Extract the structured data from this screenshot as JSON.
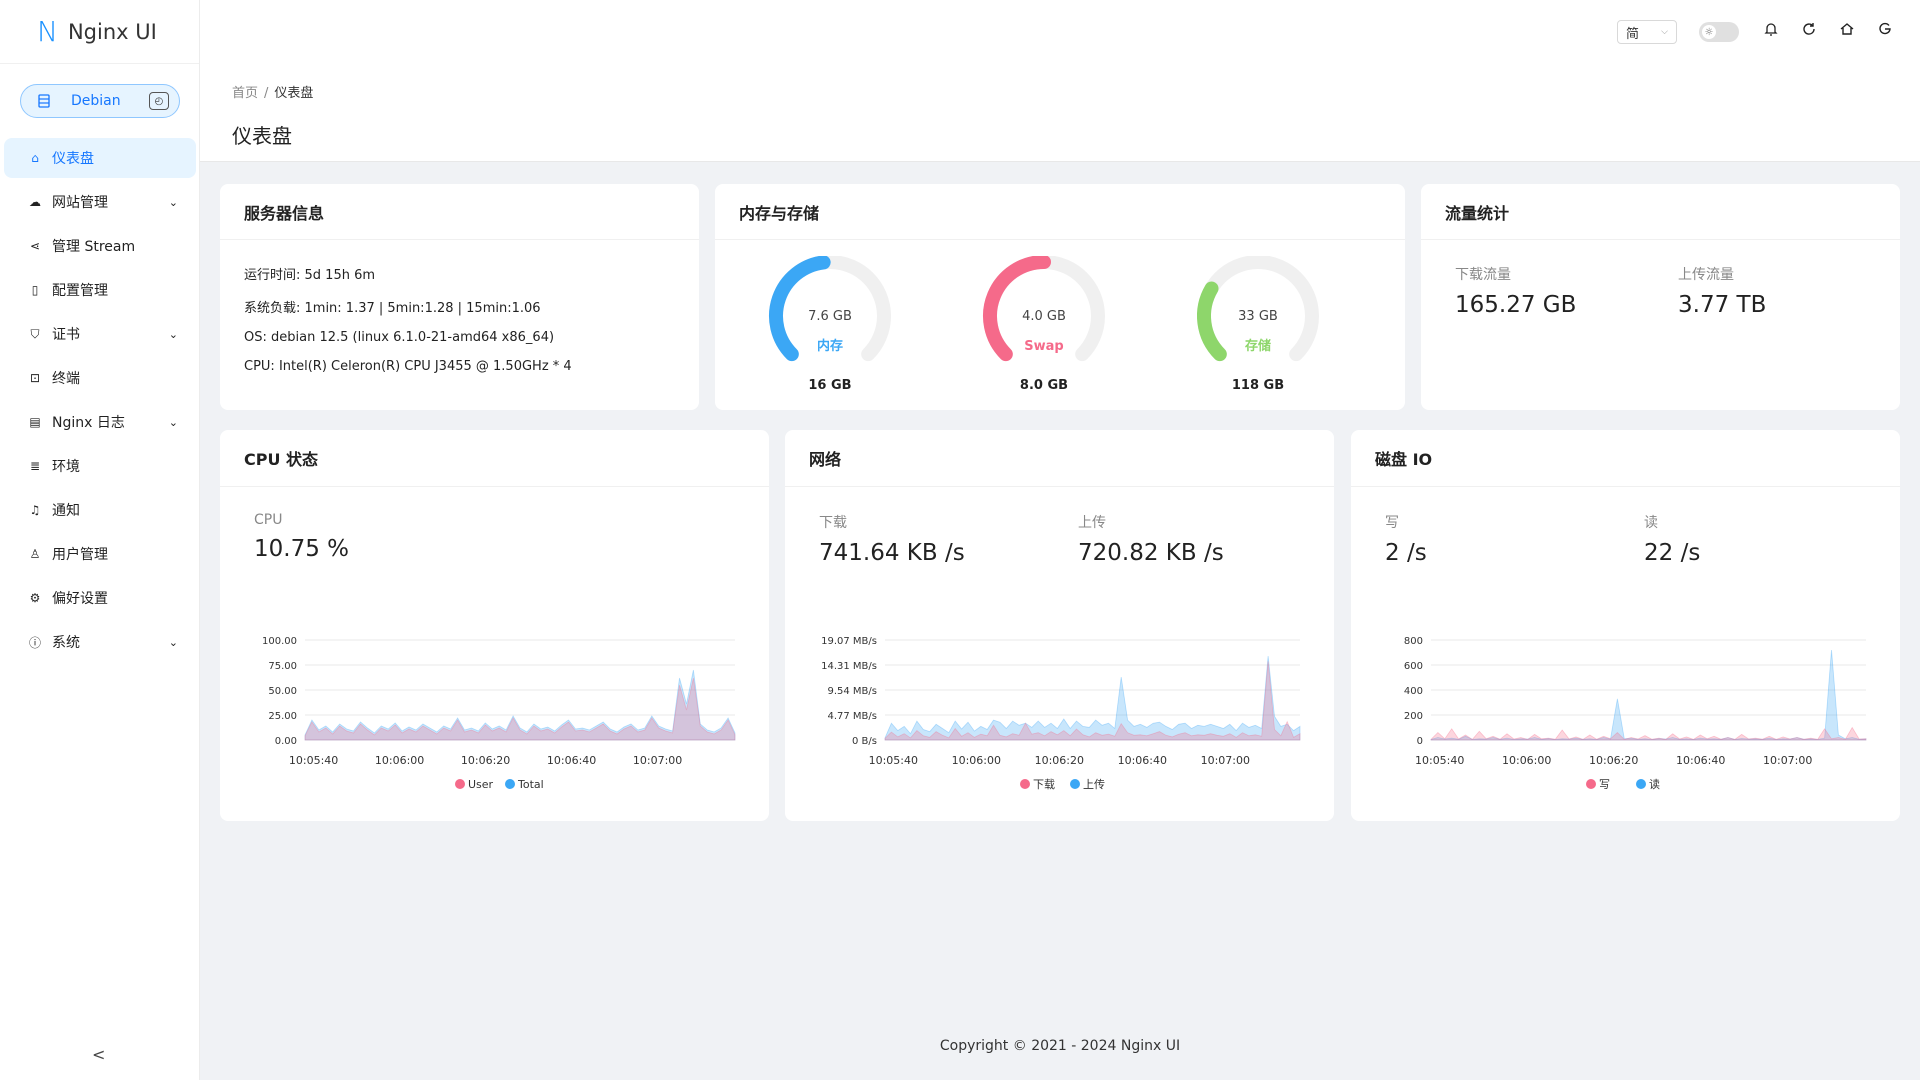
{
  "app": {
    "logo_letter": "N",
    "name": "Nginx UI"
  },
  "env": {
    "label": "Debian",
    "icon": "server-icon"
  },
  "sidebar": {
    "items": [
      {
        "label": "仪表盘",
        "icon": "home-icon",
        "active": true,
        "expandable": false
      },
      {
        "label": "网站管理",
        "icon": "cloud-icon",
        "expandable": true
      },
      {
        "label": "管理 Stream",
        "icon": "share-icon",
        "expandable": false
      },
      {
        "label": "配置管理",
        "icon": "file-icon",
        "expandable": false
      },
      {
        "label": "证书",
        "icon": "shield-icon",
        "expandable": true
      },
      {
        "label": "终端",
        "icon": "terminal-icon",
        "expandable": false
      },
      {
        "label": "Nginx 日志",
        "icon": "file-text-icon",
        "expandable": true
      },
      {
        "label": "环境",
        "icon": "database-icon",
        "expandable": false
      },
      {
        "label": "通知",
        "icon": "bell-icon",
        "expandable": false
      },
      {
        "label": "用户管理",
        "icon": "user-icon",
        "expandable": false
      },
      {
        "label": "偏好设置",
        "icon": "gear-icon",
        "expandable": false
      },
      {
        "label": "系统",
        "icon": "info-icon",
        "expandable": true
      }
    ]
  },
  "header": {
    "lang": "简"
  },
  "breadcrumb": {
    "home": "首页",
    "sep": "/",
    "current": "仪表盘"
  },
  "page_title": "仪表盘",
  "server_info": {
    "title": "服务器信息",
    "lines": [
      "运行时间: 5d 15h 6m",
      "系统负载: 1min: 1.37 | 5min:1.28 | 15min:1.06",
      "OS: debian 12.5 (linux 6.1.0-21-amd64 x86_64)",
      "CPU: Intel(R) Celeron(R) CPU J3455 @ 1.50GHz * 4"
    ]
  },
  "memory": {
    "title": "内存与存储",
    "gauges": [
      {
        "used": "7.6 GB",
        "label": "内存",
        "total": "16 GB",
        "fraction": 0.475,
        "color": "#3ba7f5"
      },
      {
        "used": "4.0 GB",
        "label": "Swap",
        "total": "8.0 GB",
        "fraction": 0.5,
        "color": "#f56a8a"
      },
      {
        "used": "33 GB",
        "label": "存储",
        "total": "118 GB",
        "fraction": 0.28,
        "color": "#8ed66b"
      }
    ]
  },
  "traffic": {
    "title": "流量统计",
    "download_label": "下载流量",
    "download_value": "165.27 GB",
    "upload_label": "上传流量",
    "upload_value": "3.77 TB"
  },
  "cpu": {
    "title": "CPU 状态",
    "label": "CPU",
    "value": "10.75 %",
    "legend": [
      "User",
      "Total"
    ]
  },
  "network": {
    "title": "网络",
    "down_label": "下载",
    "down_value": "741.64 KB /s",
    "up_label": "上传",
    "up_value": "720.82 KB /s",
    "legend": [
      "下载",
      "上传"
    ]
  },
  "disk": {
    "title": "磁盘 IO",
    "write_label": "写",
    "write_value": "2 /s",
    "read_label": "读",
    "read_value": "22 /s",
    "legend": [
      "写",
      "读"
    ]
  },
  "chart_data": [
    {
      "type": "area",
      "name": "CPU 状态",
      "x_ticks": [
        "10:05:40",
        "10:06:00",
        "10:06:20",
        "10:06:40",
        "10:07:00"
      ],
      "y_ticks": [
        "100.00",
        "75.00",
        "50.00",
        "25.00",
        "0.00"
      ],
      "ylim": [
        0,
        100
      ],
      "series": [
        {
          "name": "User",
          "color": "#f56a8a",
          "values": [
            4,
            18,
            8,
            12,
            6,
            14,
            9,
            7,
            16,
            10,
            5,
            12,
            9,
            15,
            7,
            11,
            8,
            14,
            10,
            6,
            12,
            9,
            20,
            8,
            10,
            7,
            15,
            9,
            12,
            8,
            22,
            10,
            6,
            14,
            9,
            11,
            7,
            13,
            18,
            9,
            10,
            8,
            12,
            16,
            9,
            6,
            11,
            14,
            8,
            10,
            22,
            12,
            9,
            7,
            55,
            30,
            62,
            14,
            8,
            6,
            10,
            20,
            5
          ]
        },
        {
          "name": "Total",
          "color": "#3ba7f5",
          "values": [
            5,
            20,
            10,
            14,
            8,
            16,
            11,
            9,
            18,
            12,
            7,
            14,
            11,
            17,
            9,
            13,
            10,
            16,
            12,
            8,
            14,
            11,
            22,
            10,
            12,
            9,
            17,
            11,
            14,
            10,
            24,
            12,
            8,
            16,
            11,
            13,
            9,
            15,
            20,
            11,
            12,
            10,
            14,
            18,
            11,
            8,
            13,
            16,
            10,
            12,
            24,
            14,
            11,
            9,
            62,
            36,
            70,
            16,
            10,
            8,
            12,
            22,
            7
          ]
        }
      ]
    },
    {
      "type": "area",
      "name": "网络",
      "x_ticks": [
        "10:05:40",
        "10:06:00",
        "10:06:20",
        "10:06:40",
        "10:07:00"
      ],
      "y_ticks": [
        "19.07 MB/s",
        "14.31 MB/s",
        "9.54 MB/s",
        "4.77 MB/s",
        "0 B/s"
      ],
      "ylim": [
        0,
        19.07
      ],
      "series": [
        {
          "name": "下载",
          "color": "#f56a8a",
          "values": [
            0.3,
            1.5,
            0.6,
            1.2,
            0.4,
            1.8,
            0.8,
            0.5,
            1.6,
            0.9,
            0.4,
            2.2,
            0.7,
            1.4,
            0.5,
            1.1,
            0.8,
            2.8,
            0.9,
            0.6,
            1.2,
            0.9,
            3.2,
            1.1,
            1.4,
            0.8,
            1.6,
            1.0,
            1.8,
            0.8,
            2.1,
            1.0,
            0.6,
            1.4,
            0.9,
            1.1,
            0.7,
            3.1,
            1.4,
            0.9,
            1.0,
            0.8,
            1.2,
            1.6,
            0.9,
            0.6,
            1.1,
            1.4,
            0.8,
            1.0,
            0.9,
            1.2,
            0.9,
            0.7,
            1.2,
            0.5,
            1.4,
            0.8,
            1.0,
            0.7,
            15.0,
            2.0,
            0.8,
            3.5,
            0.5,
            1.2
          ]
        },
        {
          "name": "上传",
          "color": "#3ba7f5",
          "values": [
            0.4,
            3.2,
            1.8,
            2.6,
            1.2,
            3.6,
            2.0,
            1.6,
            3.0,
            2.2,
            1.4,
            3.6,
            2.1,
            3.4,
            1.7,
            2.6,
            2.0,
            3.8,
            3.4,
            2.2,
            3.6,
            2.8,
            3.2,
            2.4,
            3.6,
            2.4,
            3.2,
            2.2,
            4.0,
            2.2,
            3.6,
            2.6,
            2.4,
            3.8,
            2.8,
            3.2,
            2.2,
            12.0,
            3.8,
            2.6,
            3.0,
            2.4,
            3.2,
            3.4,
            2.6,
            2.0,
            3.0,
            3.2,
            2.2,
            2.8,
            2.6,
            3.0,
            2.6,
            2.2,
            3.0,
            1.8,
            3.2,
            2.4,
            2.8,
            2.2,
            16.0,
            4.5,
            2.6,
            3.0,
            1.8,
            2.6
          ]
        }
      ]
    },
    {
      "type": "area",
      "name": "磁盘 IO",
      "x_ticks": [
        "10:05:40",
        "10:06:00",
        "10:06:20",
        "10:06:40",
        "10:07:00"
      ],
      "y_ticks": [
        "800",
        "600",
        "400",
        "200",
        "0"
      ],
      "ylim": [
        0,
        800
      ],
      "series": [
        {
          "name": "写",
          "color": "#f56a8a",
          "values": [
            5,
            60,
            10,
            90,
            8,
            40,
            5,
            70,
            10,
            30,
            6,
            50,
            8,
            20,
            5,
            45,
            10,
            15,
            6,
            80,
            8,
            25,
            5,
            40,
            6,
            30,
            10,
            60,
            5,
            20,
            8,
            35,
            6,
            15,
            5,
            50,
            8,
            25,
            5,
            40,
            10,
            30,
            6,
            20,
            5,
            45,
            8,
            15,
            6,
            30,
            5,
            25,
            8,
            20,
            6,
            15,
            5,
            90,
            10,
            20,
            5,
            100,
            8,
            10
          ]
        },
        {
          "name": "读",
          "color": "#3ba7f5",
          "values": [
            5,
            20,
            8,
            15,
            6,
            30,
            5,
            10,
            8,
            20,
            6,
            15,
            5,
            10,
            8,
            20,
            6,
            12,
            5,
            10,
            8,
            15,
            6,
            10,
            5,
            20,
            8,
            330,
            10,
            15,
            6,
            10,
            5,
            12,
            8,
            20,
            6,
            10,
            5,
            15,
            8,
            10,
            6,
            20,
            5,
            12,
            8,
            10,
            6,
            15,
            5,
            10,
            8,
            20,
            6,
            10,
            5,
            15,
            720,
            40,
            10,
            20,
            6,
            10
          ]
        }
      ]
    }
  ],
  "footer": "Copyright © 2021 - 2024 Nginx UI"
}
